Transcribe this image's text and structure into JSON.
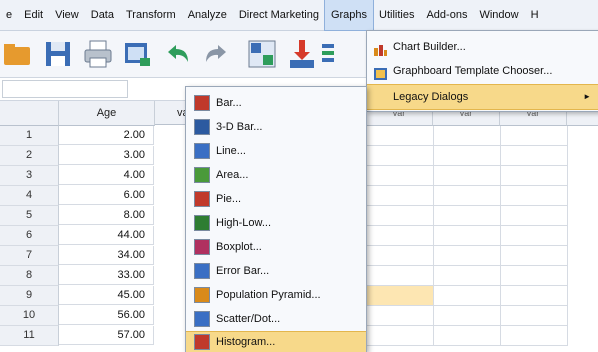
{
  "menubar": {
    "items": [
      {
        "label": "e",
        "name": "menu-file"
      },
      {
        "label": "Edit",
        "name": "menu-edit"
      },
      {
        "label": "View",
        "name": "menu-view"
      },
      {
        "label": "Data",
        "name": "menu-data"
      },
      {
        "label": "Transform",
        "name": "menu-transform"
      },
      {
        "label": "Analyze",
        "name": "menu-analyze"
      },
      {
        "label": "Direct Marketing",
        "name": "menu-direct-marketing"
      },
      {
        "label": "Graphs",
        "name": "menu-graphs"
      },
      {
        "label": "Utilities",
        "name": "menu-utilities"
      },
      {
        "label": "Add-ons",
        "name": "menu-add-ons"
      },
      {
        "label": "Window",
        "name": "menu-window"
      },
      {
        "label": "H",
        "name": "menu-help"
      }
    ]
  },
  "toolbar": {
    "icons": [
      "open-folder-icon",
      "save-icon",
      "print-icon",
      "dialog-recall-icon",
      "undo-icon",
      "redo-icon",
      "goto-case-icon",
      "goto-variable-icon",
      "variables-icon"
    ]
  },
  "grid": {
    "column_header": "Age",
    "next_column_stub": "va",
    "empty_column_header": "var",
    "rows": [
      {
        "n": "1",
        "age": "2.00"
      },
      {
        "n": "2",
        "age": "3.00"
      },
      {
        "n": "3",
        "age": "4.00"
      },
      {
        "n": "4",
        "age": "6.00"
      },
      {
        "n": "5",
        "age": "8.00"
      },
      {
        "n": "6",
        "age": "44.00"
      },
      {
        "n": "7",
        "age": "34.00"
      },
      {
        "n": "8",
        "age": "33.00"
      },
      {
        "n": "9",
        "age": "45.00"
      },
      {
        "n": "10",
        "age": "56.00"
      },
      {
        "n": "11",
        "age": "57.00"
      }
    ]
  },
  "graphs_menu": {
    "chart_builder": "Chart Builder...",
    "template_chooser": "Graphboard Template Chooser...",
    "legacy_dialogs": "Legacy Dialogs",
    "submenu_arrow": "►"
  },
  "legacy_menu": {
    "items": [
      {
        "label": "Bar...",
        "name": "legacy-item-bar",
        "icon": "bar-chart-icon",
        "color": "#c0392b"
      },
      {
        "label": "3-D Bar...",
        "name": "legacy-item-3d-bar",
        "icon": "3d-bar-chart-icon",
        "color": "#2c5aa0"
      },
      {
        "label": "Line...",
        "name": "legacy-item-line",
        "icon": "line-chart-icon",
        "color": "#3a6fc4"
      },
      {
        "label": "Area...",
        "name": "legacy-item-area",
        "icon": "area-chart-icon",
        "color": "#4a9a3a"
      },
      {
        "label": "Pie...",
        "name": "legacy-item-pie",
        "icon": "pie-chart-icon",
        "color": "#c0392b"
      },
      {
        "label": "High-Low...",
        "name": "legacy-item-high-low",
        "icon": "high-low-chart-icon",
        "color": "#2e7d32"
      },
      {
        "label": "Boxplot...",
        "name": "legacy-item-boxplot",
        "icon": "boxplot-icon",
        "color": "#b03060"
      },
      {
        "label": "Error Bar...",
        "name": "legacy-item-error-bar",
        "icon": "error-bar-icon",
        "color": "#3a6fc4"
      },
      {
        "label": "Population Pyramid...",
        "name": "legacy-item-population-pyramid",
        "icon": "population-pyramid-icon",
        "color": "#d98a1a"
      },
      {
        "label": "Scatter/Dot...",
        "name": "legacy-item-scatter-dot",
        "icon": "scatter-dot-icon",
        "color": "#3a6fc4"
      },
      {
        "label": "Histogram...",
        "name": "legacy-item-histogram",
        "icon": "histogram-icon",
        "color": "#c0392b"
      }
    ]
  },
  "colors": {
    "highlight": "#f7d98a",
    "selected_cell": "#fde6b2",
    "menubar_bg": "#eef2f8"
  }
}
